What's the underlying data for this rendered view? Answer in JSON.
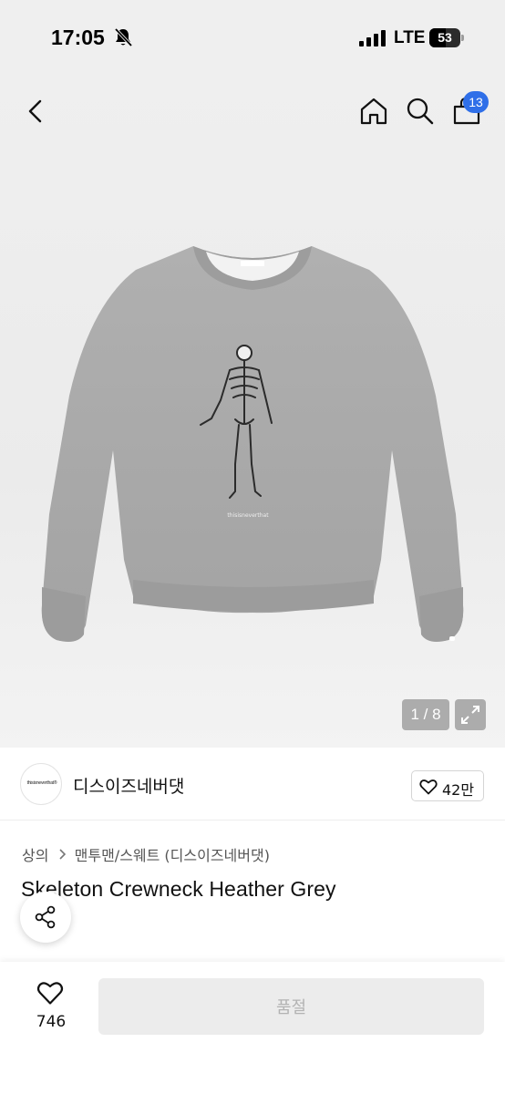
{
  "status_bar": {
    "time": "17:05",
    "network": "LTE",
    "battery": "53",
    "battery_level": 0.53,
    "icons": [
      "bell-off-icon",
      "signal-icon",
      "battery-icon"
    ]
  },
  "header": {
    "cart_count": "13",
    "icons": [
      "chevron-left-icon",
      "home-icon",
      "search-icon",
      "shopping-bag-icon"
    ]
  },
  "gallery": {
    "counter": "1 / 8",
    "icons": [
      "expand-icon"
    ]
  },
  "brand": {
    "logo_text": "thisisneverthat®",
    "name": "디스이즈네버댓",
    "likes": "42만"
  },
  "product": {
    "breadcrumb": [
      "상의",
      "맨투맨/스웨트 (디스이즈네버댓)"
    ],
    "title": "Skeleton Crewneck Heather Grey"
  },
  "bottom": {
    "wish_count": "746",
    "buy_label": "품절"
  },
  "colors": {
    "badge": "#2f6fe8",
    "sweater": "#a9a9a9",
    "disabled_button": "#ececec"
  }
}
